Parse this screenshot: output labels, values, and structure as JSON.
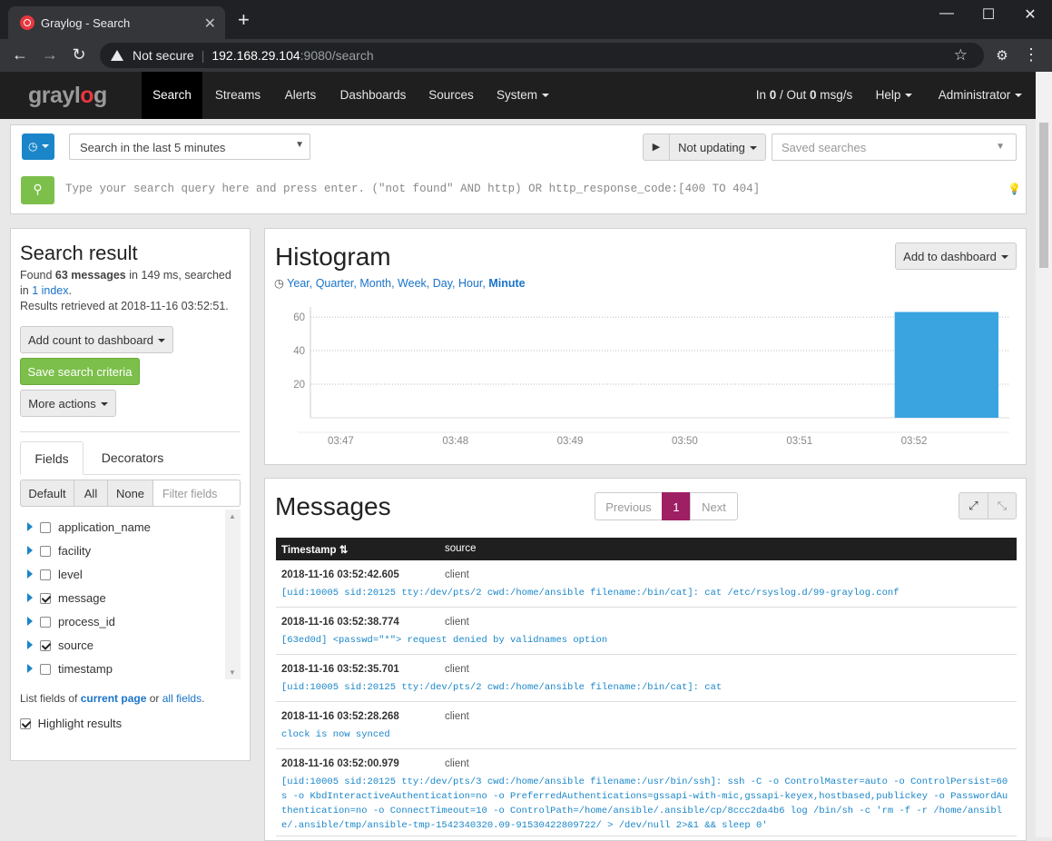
{
  "browser": {
    "tab_title": "Graylog - Search",
    "tab_close": "✕",
    "new_tab": "+",
    "win_min": "—",
    "win_max": "☐",
    "win_close": "✕",
    "security_label": "Not secure",
    "url_host": "192.168.29.104",
    "url_path": ":9080/search",
    "icons": [
      "back-icon",
      "forward-icon",
      "reload-icon",
      "warning-icon",
      "star-icon",
      "extension-icon",
      "menu-icon"
    ]
  },
  "nav": {
    "logo_a": "gray",
    "logo_b": "l",
    "logo_c": "o",
    "logo_d": "g",
    "items": [
      "Search",
      "Streams",
      "Alerts",
      "Dashboards",
      "Sources",
      "System"
    ],
    "throughput_in": "In ",
    "throughput_in_val": "0",
    "throughput_out": " / Out ",
    "throughput_out_val": "0",
    "throughput_unit": " msg/s",
    "help": "Help",
    "user": "Administrator"
  },
  "searchbar": {
    "timerange": "Search in the last 5 minutes",
    "play": "▶",
    "refresh": "Not updating",
    "saved_placeholder": "Saved searches",
    "query_placeholder": "Type your search query here and press enter. (\"not found\" AND http) OR http_response_code:[400 TO 404]"
  },
  "result": {
    "title": "Search result",
    "found": "Found ",
    "count": "63 messages",
    "in_ms": " in 149 ms, searched in ",
    "indices": "1 index",
    "period": ".",
    "retrieved": "Results retrieved at 2018-11-16 03:52:51.",
    "add_count": "Add count to dashboard",
    "save_criteria": "Save search criteria",
    "more_actions": "More actions",
    "tab_fields": "Fields",
    "tab_decorators": "Decorators",
    "filter_default": "Default",
    "filter_all": "All",
    "filter_none": "None",
    "filter_placeholder": "Filter fields",
    "fields": [
      {
        "name": "application_name",
        "checked": false
      },
      {
        "name": "facility",
        "checked": false
      },
      {
        "name": "level",
        "checked": false
      },
      {
        "name": "message",
        "checked": true
      },
      {
        "name": "process_id",
        "checked": false
      },
      {
        "name": "source",
        "checked": true
      },
      {
        "name": "timestamp",
        "checked": false
      }
    ],
    "list_fields_a": "List fields of ",
    "list_fields_current": "current page",
    "list_fields_or": " or ",
    "list_fields_all": "all fields",
    "list_fields_end": ".",
    "highlight": "Highlight results"
  },
  "histogram": {
    "title": "Histogram",
    "add_to_dashboard": "Add to dashboard",
    "resolutions": [
      "Year",
      "Quarter",
      "Month",
      "Week",
      "Day",
      "Hour",
      "Minute"
    ],
    "active_resolution": "Minute",
    "clock_icon": "clock-icon"
  },
  "chart_data": {
    "type": "bar",
    "categories": [
      "03:47",
      "03:48",
      "03:49",
      "03:50",
      "03:51",
      "03:52"
    ],
    "values": [
      0,
      0,
      0,
      0,
      0,
      63
    ],
    "yticks": [
      20,
      40,
      60
    ],
    "ylim": [
      0,
      66
    ],
    "bar_color": "#3aa4e0",
    "grid": true
  },
  "messages": {
    "title": "Messages",
    "prev": "Previous",
    "page": "1",
    "next": "Next",
    "col_timestamp": "Timestamp",
    "col_source": "source",
    "rows": [
      {
        "ts": "2018-11-16 03:52:42.605",
        "source": "client",
        "text": "[uid:10005 sid:20125 tty:/dev/pts/2 cwd:/home/ansible filename:/bin/cat]: cat /etc/rsyslog.d/99-graylog.conf"
      },
      {
        "ts": "2018-11-16 03:52:38.774",
        "source": "client",
        "text": "[63ed0d] <passwd=\"*\"> request denied by validnames option"
      },
      {
        "ts": "2018-11-16 03:52:35.701",
        "source": "client",
        "text": "[uid:10005 sid:20125 tty:/dev/pts/2 cwd:/home/ansible filename:/bin/cat]: cat"
      },
      {
        "ts": "2018-11-16 03:52:28.268",
        "source": "client",
        "text": "clock is now synced"
      },
      {
        "ts": "2018-11-16 03:52:00.979",
        "source": "client",
        "text": "[uid:10005 sid:20125 tty:/dev/pts/3 cwd:/home/ansible filename:/usr/bin/ssh]: ssh -C -o ControlMaster=auto -o ControlPersist=60s -o KbdInteractiveAuthentication=no -o PreferredAuthentications=gssapi-with-mic,gssapi-keyex,hostbased,publickey -o PasswordAuthentication=no -o ConnectTimeout=10 -o ControlPath=/home/ansible/.ansible/cp/8ccc2da4b6 log /bin/sh -c 'rm -f -r /home/ansible/.ansible/tmp/ansible-tmp-1542340320.09-91530422809722/ > /dev/null 2>&1 && sleep 0'"
      }
    ]
  }
}
